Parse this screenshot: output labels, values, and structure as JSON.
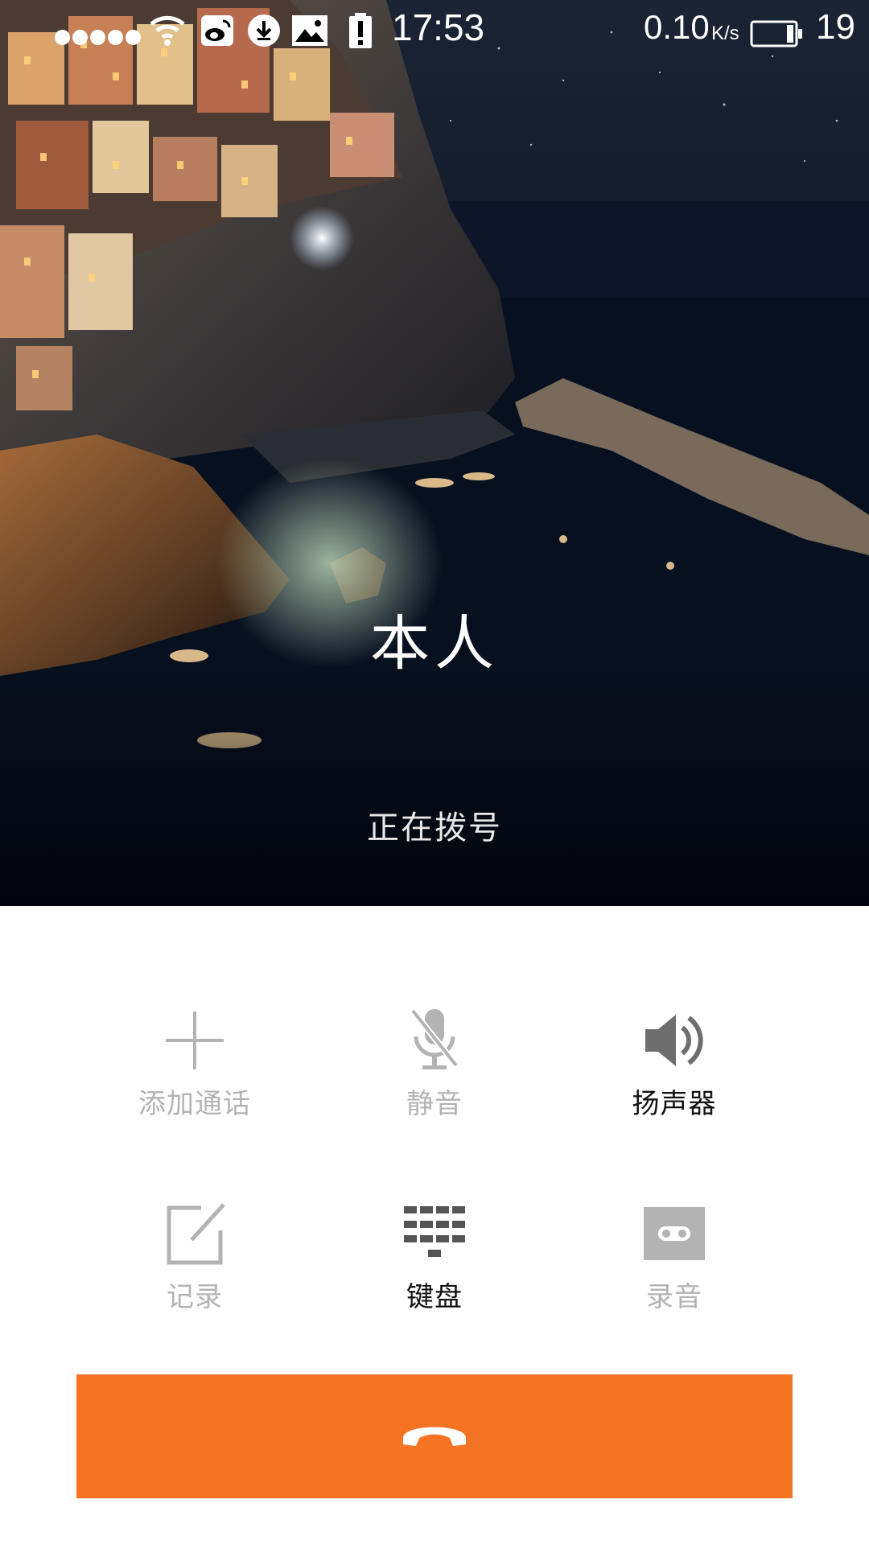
{
  "status_bar": {
    "signal_dots": 5,
    "time": "17:53",
    "net_speed": "0.10",
    "net_speed_unit": "K/s",
    "battery_level": "19",
    "icons": [
      "signal-icon",
      "wifi-icon",
      "weibo-icon",
      "download-icon",
      "image-icon",
      "alert-icon",
      "battery-icon"
    ]
  },
  "call": {
    "caller_name": "本人",
    "status": "正在拨号"
  },
  "controls": {
    "add_call": {
      "label": "添加通话",
      "icon": "plus-icon",
      "active": false
    },
    "mute": {
      "label": "静音",
      "icon": "mic-off-icon",
      "active": false
    },
    "speaker": {
      "label": "扬声器",
      "icon": "speaker-icon",
      "active": true
    },
    "notes": {
      "label": "记录",
      "icon": "edit-note-icon",
      "active": false
    },
    "keypad": {
      "label": "键盘",
      "icon": "keypad-icon",
      "active": true
    },
    "record": {
      "label": "录音",
      "icon": "record-tape-icon",
      "active": false
    }
  },
  "end_call": {
    "icon": "hang-up-icon",
    "color": "#f47424"
  },
  "colors": {
    "accent": "#f47424",
    "inactive_label": "#b3b3b3",
    "active_label": "#111111"
  }
}
